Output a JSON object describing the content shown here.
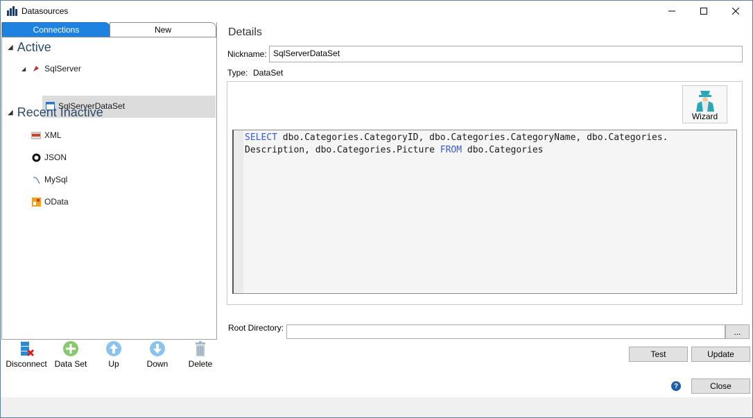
{
  "window": {
    "title": "Datasources"
  },
  "tabs": [
    {
      "label": "Connections",
      "active": true
    },
    {
      "label": "New",
      "active": false
    }
  ],
  "tree": {
    "active_header": "Active",
    "active_items": [
      {
        "label": "SqlServer",
        "icon": "sqlserver-icon"
      }
    ],
    "active_children": [
      {
        "label": "SqlServerDataSet",
        "icon": "dataset-window-icon",
        "selected": true
      }
    ],
    "inactive_header": "Recent Inactive",
    "inactive_items": [
      {
        "label": "XML",
        "icon": "xml-icon"
      },
      {
        "label": "JSON",
        "icon": "json-icon"
      },
      {
        "label": "MySql",
        "icon": "mysql-icon"
      },
      {
        "label": "OData",
        "icon": "odata-icon"
      }
    ]
  },
  "toolbar": {
    "disconnect": "Disconnect",
    "dataset": "Data Set",
    "up": "Up",
    "down": "Down",
    "delete": "Delete"
  },
  "details": {
    "title": "Details",
    "nickname_label": "Nickname:",
    "nickname_value": "SqlServerDataSet",
    "type_label": "Type:",
    "type_value": "DataSet",
    "wizard_label": "Wizard",
    "sql": {
      "line1_kw": "SELECT",
      "line1_rest": " dbo.Categories.CategoryID, dbo.Categories.CategoryName, dbo.Categories.",
      "line2_a": "Description, dbo.Categories.Picture ",
      "line2_kw": "FROM",
      "line2_b": " dbo.Categories"
    },
    "root_dir_label": "Root Directory:",
    "root_dir_value": "",
    "browse_label": "...",
    "test_label": "Test",
    "update_label": "Update",
    "close_label": "Close",
    "help_glyph": "?"
  },
  "colors": {
    "accent": "#1e83e0",
    "keyword": "#3a5ad0",
    "selection": "#dcdcdc"
  }
}
